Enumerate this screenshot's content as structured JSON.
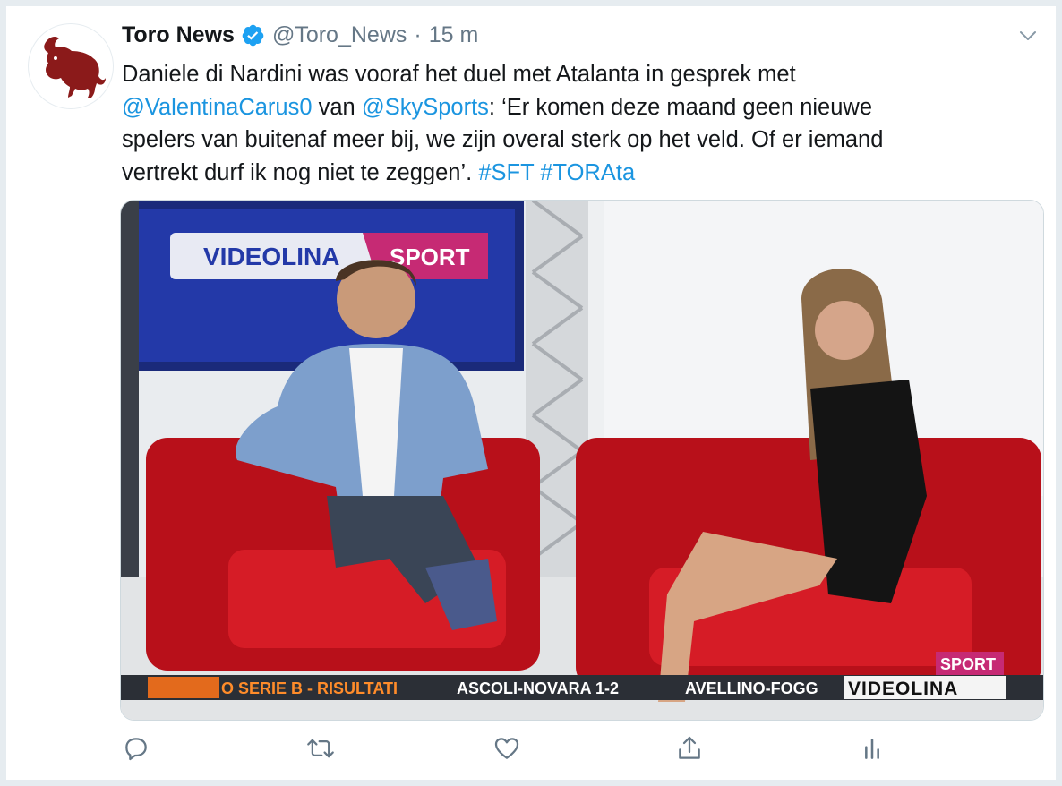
{
  "tweet": {
    "author": {
      "display_name": "Toro News",
      "handle": "@Toro_News",
      "separator": "·",
      "time": "15 m"
    },
    "text": {
      "line1": "Daniele di Nardini was vooraf het duel met Atalanta in gesprek met",
      "mention1": "@ValentinaCarus0",
      "line2_mid": " van ",
      "mention2": "@SkySports",
      "line2_end": ": ‘Er komen deze maand geen nieuwe",
      "line3": "spelers van buitenaf meer bij, we zijn overal sterk op het veld. Of er iemand",
      "line4": "vertrekt durf ik nog niet te zeggen’. ",
      "hashtag1": "#SFT",
      "hashtag_sep": " ",
      "hashtag2": "#TORAta"
    },
    "media": {
      "studio_logo_left": "VIDEOLINA",
      "studio_logo_right": "SPORT",
      "corner_logo": "SPORT",
      "ticker_left": "O SERIE B - RISULTATI",
      "ticker_mid": "ASCOLI-NOVARA 1-2",
      "ticker_right": "AVELLINO-FOGG",
      "ticker_brand": "VIDEOLINA"
    },
    "actions": [
      "reply-icon",
      "retweet-icon",
      "like-icon",
      "share-icon",
      "analytics-icon"
    ]
  },
  "colors": {
    "link": "#1b95e0",
    "text": "#14171a",
    "muted": "#657786",
    "verified": "#1da1f2",
    "chair_red": "#c8141c",
    "bull_red": "#8b1a1a"
  }
}
